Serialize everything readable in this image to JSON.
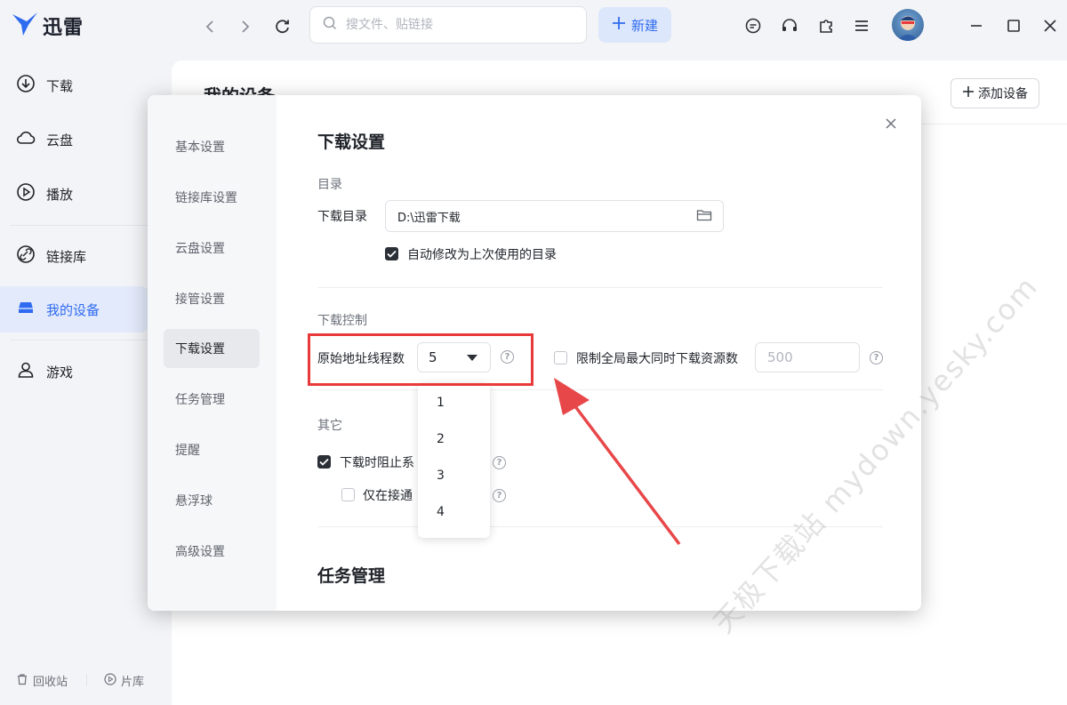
{
  "app": {
    "name": "迅雷"
  },
  "search": {
    "placeholder": "搜文件、贴链接"
  },
  "toolbar": {
    "new_label": "新建"
  },
  "sidebar": {
    "items": [
      {
        "label": "下载",
        "icon": "download-icon"
      },
      {
        "label": "云盘",
        "icon": "cloud-icon"
      },
      {
        "label": "播放",
        "icon": "play-icon"
      },
      {
        "label": "链接库",
        "icon": "link-icon"
      },
      {
        "label": "我的设备",
        "icon": "device-icon",
        "active": true
      },
      {
        "label": "游戏",
        "icon": "user-icon"
      }
    ],
    "footer": {
      "recycle": "回收站",
      "library": "片库"
    }
  },
  "main": {
    "title": "我的设备",
    "add_device": "添加设备"
  },
  "settings": {
    "nav": [
      {
        "label": "基本设置"
      },
      {
        "label": "链接库设置"
      },
      {
        "label": "云盘设置"
      },
      {
        "label": "接管设置"
      },
      {
        "label": "下载设置",
        "active": true
      },
      {
        "label": "任务管理"
      },
      {
        "label": "提醒"
      },
      {
        "label": "悬浮球"
      },
      {
        "label": "高级设置"
      }
    ],
    "download": {
      "section_title": "下载设置",
      "dir_group": "目录",
      "dir_label": "下载目录",
      "dir_value": "D:\\迅雷下载",
      "auto_modify_label": "自动修改为上次使用的目录",
      "auto_modify_checked": true,
      "control_group": "下载控制",
      "threads_label": "原始地址线程数",
      "threads_value": "5",
      "threads_options": [
        "1",
        "2",
        "3",
        "4"
      ],
      "limit_label": "限制全局最大同时下载资源数",
      "limit_checked": false,
      "limit_placeholder": "500",
      "other_group": "其它",
      "prevent_sleep_label": "下载时阻止系",
      "prevent_sleep_checked": true,
      "only_when_label": "仅在接通",
      "only_when_checked": false
    },
    "task_section_title": "任务管理"
  },
  "watermark": "天极下载站 mydown.yesky.com",
  "colors": {
    "accent": "#2f6bf0",
    "highlight": "#e83a3a"
  }
}
